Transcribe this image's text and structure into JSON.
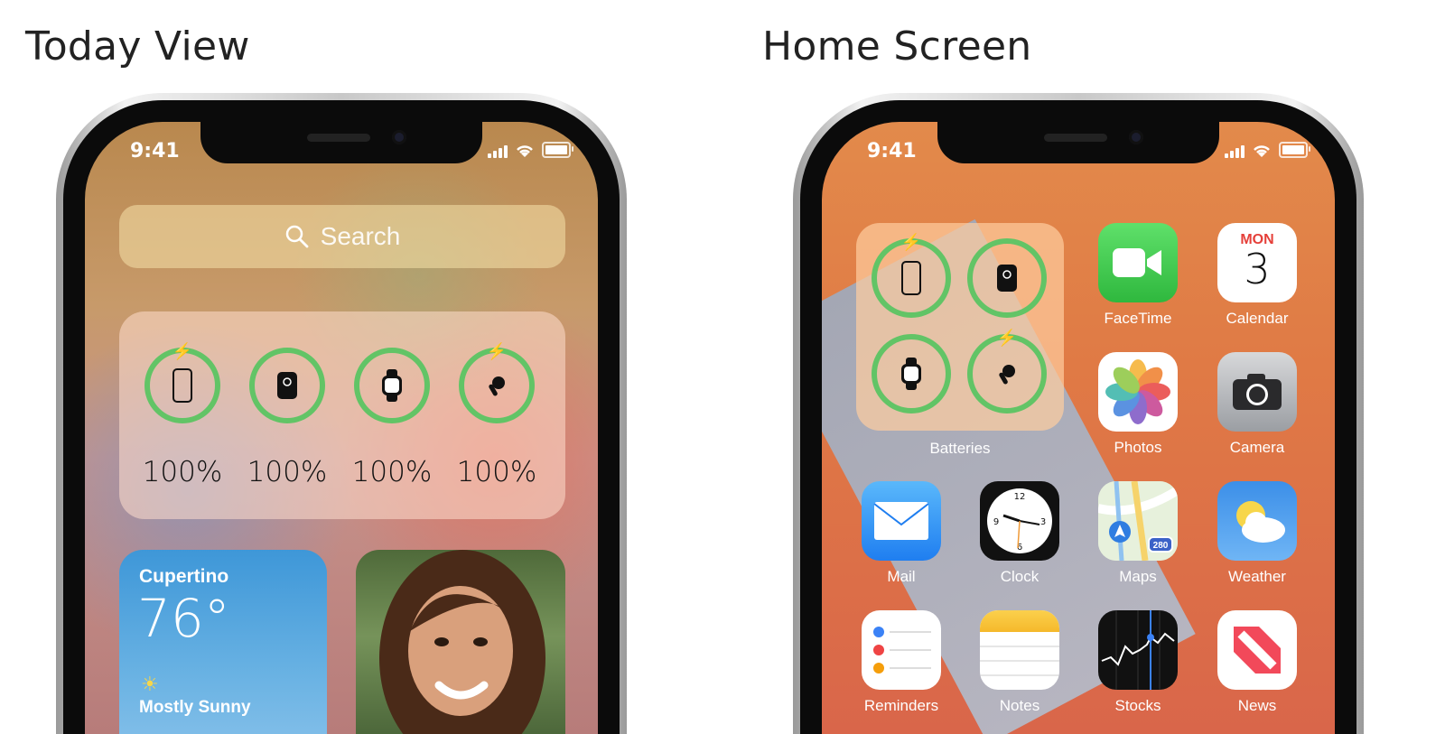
{
  "headings": {
    "left": "Today View",
    "right": "Home Screen"
  },
  "status_bar": {
    "time": "9:41"
  },
  "today_view": {
    "search_placeholder": "Search",
    "batteries": [
      {
        "device": "iPhone",
        "percent": "100%",
        "charging": true
      },
      {
        "device": "MagSafe Battery",
        "percent": "100%",
        "charging": false
      },
      {
        "device": "Apple Watch",
        "percent": "100%",
        "charging": false
      },
      {
        "device": "AirPods",
        "percent": "100%",
        "charging": true
      }
    ],
    "weather": {
      "city": "Cupertino",
      "temp": "76°",
      "condition": "Mostly Sunny"
    }
  },
  "home_screen": {
    "widget_label": "Batteries",
    "calendar": {
      "day": "MON",
      "date": "3"
    },
    "maps_badge": "280",
    "apps": [
      {
        "id": "facetime",
        "label": "FaceTime"
      },
      {
        "id": "calendar",
        "label": "Calendar"
      },
      {
        "id": "photos",
        "label": "Photos"
      },
      {
        "id": "camera",
        "label": "Camera"
      },
      {
        "id": "mail",
        "label": "Mail"
      },
      {
        "id": "clock",
        "label": "Clock"
      },
      {
        "id": "maps",
        "label": "Maps"
      },
      {
        "id": "weather",
        "label": "Weather"
      },
      {
        "id": "reminders",
        "label": "Reminders"
      },
      {
        "id": "notes",
        "label": "Notes"
      },
      {
        "id": "stocks",
        "label": "Stocks"
      },
      {
        "id": "news",
        "label": "News"
      }
    ]
  },
  "colors": {
    "battery_ring": "#62c466"
  }
}
